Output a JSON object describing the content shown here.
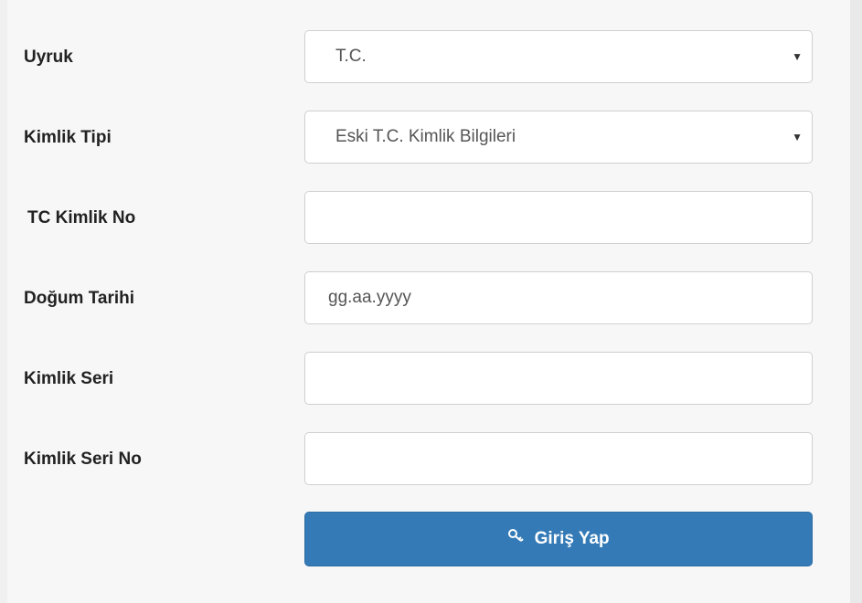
{
  "form": {
    "nationality": {
      "label": "Uyruk",
      "selected": "T.C."
    },
    "id_type": {
      "label": "Kimlik Tipi",
      "selected": "Eski T.C. Kimlik Bilgileri"
    },
    "tc_no": {
      "label": "TC Kimlik No",
      "value": "",
      "placeholder": ""
    },
    "birth_date": {
      "label": "Doğum Tarihi",
      "value": "",
      "placeholder": "gg.aa.yyyy"
    },
    "id_serial": {
      "label": "Kimlik Seri",
      "value": "",
      "placeholder": ""
    },
    "id_serial_no": {
      "label": "Kimlik Seri No",
      "value": "",
      "placeholder": ""
    },
    "submit": {
      "label": "Giriş Yap",
      "icon": "key-icon"
    }
  },
  "colors": {
    "button_bg": "#337ab7",
    "button_text": "#ffffff",
    "page_bg": "#f7f7f7"
  }
}
